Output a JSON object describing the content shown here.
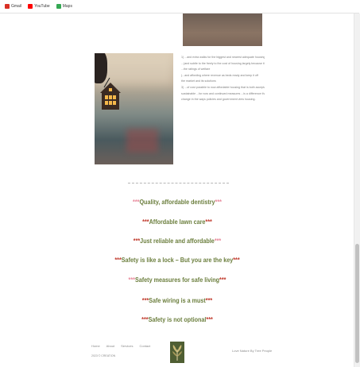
{
  "bookmarks": [
    {
      "label": "Gmail",
      "icon": "gmail-icon",
      "color": "#d93025"
    },
    {
      "label": "YouTube",
      "icon": "youtube-icon",
      "color": "#ff0000"
    },
    {
      "label": "Maps",
      "icon": "maps-icon",
      "color": "#34a853"
    }
  ],
  "paragraphs": [
    "1) ...and extra walks for the biggest and nearest adequate housing",
    "...(and subtle to the freely to the cost of housing largely because it",
    "...the ratings of welfare",
    "(...and affording where revenue as beds ready and keep it off",
    "the market and its solutions",
    "3) ...of cost possible to now affordable housing that is both acceptable and",
    "sustainable ...for now and continued measures ...is a difference that takes a",
    "change in the ways policies and government view housing."
  ],
  "slogans": [
    {
      "text": "Quality, affordable dentistry",
      "star_style": "pink"
    },
    {
      "text": "Affordable lawn care",
      "star_style": "red"
    },
    {
      "text": "Just reliable and affordable",
      "star_style": "red-pink"
    },
    {
      "text": "Safety is like a lock – But you are the key",
      "star_style": "red"
    },
    {
      "text": "Safety measures for safe living",
      "star_style": "pink-red"
    },
    {
      "text": "Safe wiring is a must",
      "star_style": "red"
    },
    {
      "text": "Safety is not optional",
      "star_style": "red"
    }
  ],
  "footer": {
    "links": [
      "Home",
      "About",
      "Services",
      "Contact"
    ],
    "copyright": "2023 © CREATION",
    "credit": "Love Nature By Tree People"
  },
  "colors": {
    "slogan_text": "#6b7e3d",
    "star_red": "#c0392b",
    "star_pink": "#e88a9c"
  }
}
